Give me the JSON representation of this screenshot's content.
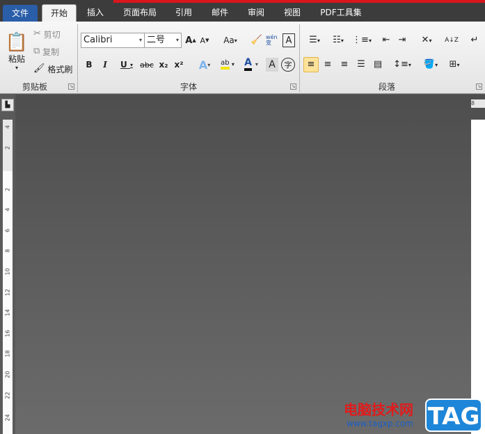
{
  "tabs": [
    "文件",
    "开始",
    "插入",
    "页面布局",
    "引用",
    "邮件",
    "审阅",
    "视图",
    "PDF工具集"
  ],
  "clipboard": {
    "paste": "粘贴",
    "cut": "剪切",
    "copy": "复制",
    "format_painter": "格式刷",
    "group": "剪贴板"
  },
  "font": {
    "name": "Calibri",
    "size": "二号",
    "group": "字体",
    "grow": "A",
    "shrink": "A",
    "case": "Aa",
    "bold": "B",
    "italic": "I",
    "underline": "U",
    "strike": "abc",
    "sub": "x₂",
    "sup": "x²",
    "text_effect": "A",
    "highlight": "ab",
    "font_color": "A",
    "char_shade": "A",
    "enclose": "字",
    "phonetic": "wén 变",
    "border_char": "A"
  },
  "paragraph": {
    "group": "段落",
    "sort": "A↓Z"
  },
  "ruler": {
    "numbers": [
      "4",
      "2",
      "2",
      "4",
      "6",
      "8",
      "10",
      "12",
      "14",
      "16",
      "18",
      "20",
      "22",
      "24"
    ],
    "top_marker": "8"
  },
  "watermark": {
    "line1": "电脑技术网",
    "line2": "www.tagxp.com",
    "logo": "TAG"
  },
  "colors": {
    "file_tab": "#2a5ea8",
    "accent_red": "#d9161c",
    "highlight": "#fde39a"
  }
}
